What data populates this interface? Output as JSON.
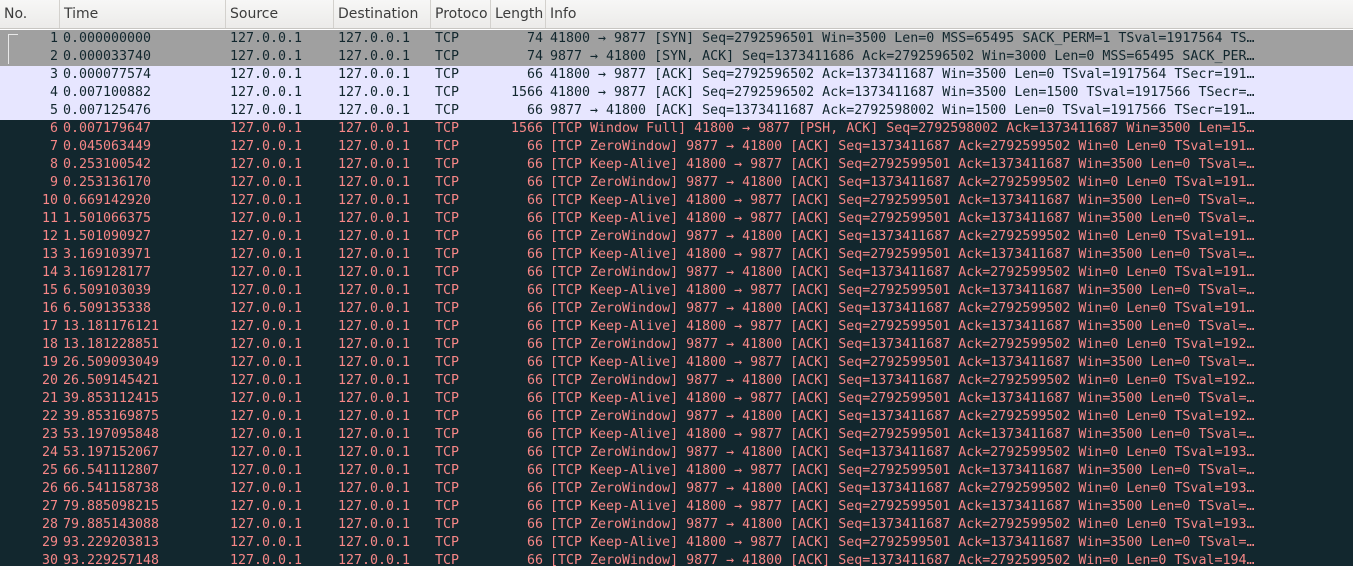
{
  "columns": [
    {
      "key": "no",
      "label": "No."
    },
    {
      "key": "time",
      "label": "Time"
    },
    {
      "key": "source",
      "label": "Source"
    },
    {
      "key": "destination",
      "label": "Destination"
    },
    {
      "key": "protocol",
      "label": "Protoco"
    },
    {
      "key": "length",
      "label": "Length"
    },
    {
      "key": "info",
      "label": "Info"
    }
  ],
  "colors": {
    "gray_bg": "#a0a0a0",
    "gray_fg": "#12272e",
    "lavender_bg": "#e7e6ff",
    "lavender_fg": "#12272e",
    "dark_bg": "#12272e",
    "dark_fg": "#f78787"
  },
  "packets": [
    {
      "no": "1",
      "time": "0.000000000",
      "source": "127.0.0.1",
      "destination": "127.0.0.1",
      "protocol": "TCP",
      "length": "74",
      "info": "41800 → 9877 [SYN] Seq=2792596501 Win=3500 Len=0 MSS=65495 SACK_PERM=1 TSval=1917564 TS…",
      "style": "gray"
    },
    {
      "no": "2",
      "time": "0.000033740",
      "source": "127.0.0.1",
      "destination": "127.0.0.1",
      "protocol": "TCP",
      "length": "74",
      "info": "9877 → 41800 [SYN, ACK] Seq=1373411686 Ack=2792596502 Win=3000 Len=0 MSS=65495 SACK_PER…",
      "style": "gray"
    },
    {
      "no": "3",
      "time": "0.000077574",
      "source": "127.0.0.1",
      "destination": "127.0.0.1",
      "protocol": "TCP",
      "length": "66",
      "info": "41800 → 9877 [ACK] Seq=2792596502 Ack=1373411687 Win=3500 Len=0 TSval=1917564 TSecr=191…",
      "style": "lavender"
    },
    {
      "no": "4",
      "time": "0.007100882",
      "source": "127.0.0.1",
      "destination": "127.0.0.1",
      "protocol": "TCP",
      "length": "1566",
      "info": "41800 → 9877 [ACK] Seq=2792596502 Ack=1373411687 Win=3500 Len=1500 TSval=1917566 TSecr=…",
      "style": "lavender"
    },
    {
      "no": "5",
      "time": "0.007125476",
      "source": "127.0.0.1",
      "destination": "127.0.0.1",
      "protocol": "TCP",
      "length": "66",
      "info": "9877 → 41800 [ACK] Seq=1373411687 Ack=2792598002 Win=1500 Len=0 TSval=1917566 TSecr=191…",
      "style": "lavender"
    },
    {
      "no": "6",
      "time": "0.007179647",
      "source": "127.0.0.1",
      "destination": "127.0.0.1",
      "protocol": "TCP",
      "length": "1566",
      "info": "[TCP Window Full] 41800 → 9877 [PSH, ACK] Seq=2792598002 Ack=1373411687 Win=3500 Len=15…",
      "style": "dark"
    },
    {
      "no": "7",
      "time": "0.045063449",
      "source": "127.0.0.1",
      "destination": "127.0.0.1",
      "protocol": "TCP",
      "length": "66",
      "info": "[TCP ZeroWindow] 9877 → 41800 [ACK] Seq=1373411687 Ack=2792599502 Win=0 Len=0 TSval=191…",
      "style": "dark"
    },
    {
      "no": "8",
      "time": "0.253100542",
      "source": "127.0.0.1",
      "destination": "127.0.0.1",
      "protocol": "TCP",
      "length": "66",
      "info": "[TCP Keep-Alive] 41800 → 9877 [ACK] Seq=2792599501 Ack=1373411687 Win=3500 Len=0 TSval=…",
      "style": "dark"
    },
    {
      "no": "9",
      "time": "0.253136170",
      "source": "127.0.0.1",
      "destination": "127.0.0.1",
      "protocol": "TCP",
      "length": "66",
      "info": "[TCP ZeroWindow] 9877 → 41800 [ACK] Seq=1373411687 Ack=2792599502 Win=0 Len=0 TSval=191…",
      "style": "dark"
    },
    {
      "no": "10",
      "time": "0.669142920",
      "source": "127.0.0.1",
      "destination": "127.0.0.1",
      "protocol": "TCP",
      "length": "66",
      "info": "[TCP Keep-Alive] 41800 → 9877 [ACK] Seq=2792599501 Ack=1373411687 Win=3500 Len=0 TSval=…",
      "style": "dark"
    },
    {
      "no": "11",
      "time": "1.501066375",
      "source": "127.0.0.1",
      "destination": "127.0.0.1",
      "protocol": "TCP",
      "length": "66",
      "info": "[TCP Keep-Alive] 41800 → 9877 [ACK] Seq=2792599501 Ack=1373411687 Win=3500 Len=0 TSval=…",
      "style": "dark"
    },
    {
      "no": "12",
      "time": "1.501090927",
      "source": "127.0.0.1",
      "destination": "127.0.0.1",
      "protocol": "TCP",
      "length": "66",
      "info": "[TCP ZeroWindow] 9877 → 41800 [ACK] Seq=1373411687 Ack=2792599502 Win=0 Len=0 TSval=191…",
      "style": "dark"
    },
    {
      "no": "13",
      "time": "3.169103971",
      "source": "127.0.0.1",
      "destination": "127.0.0.1",
      "protocol": "TCP",
      "length": "66",
      "info": "[TCP Keep-Alive] 41800 → 9877 [ACK] Seq=2792599501 Ack=1373411687 Win=3500 Len=0 TSval=…",
      "style": "dark"
    },
    {
      "no": "14",
      "time": "3.169128177",
      "source": "127.0.0.1",
      "destination": "127.0.0.1",
      "protocol": "TCP",
      "length": "66",
      "info": "[TCP ZeroWindow] 9877 → 41800 [ACK] Seq=1373411687 Ack=2792599502 Win=0 Len=0 TSval=191…",
      "style": "dark"
    },
    {
      "no": "15",
      "time": "6.509103039",
      "source": "127.0.0.1",
      "destination": "127.0.0.1",
      "protocol": "TCP",
      "length": "66",
      "info": "[TCP Keep-Alive] 41800 → 9877 [ACK] Seq=2792599501 Ack=1373411687 Win=3500 Len=0 TSval=…",
      "style": "dark"
    },
    {
      "no": "16",
      "time": "6.509135338",
      "source": "127.0.0.1",
      "destination": "127.0.0.1",
      "protocol": "TCP",
      "length": "66",
      "info": "[TCP ZeroWindow] 9877 → 41800 [ACK] Seq=1373411687 Ack=2792599502 Win=0 Len=0 TSval=191…",
      "style": "dark"
    },
    {
      "no": "17",
      "time": "13.181176121",
      "source": "127.0.0.1",
      "destination": "127.0.0.1",
      "protocol": "TCP",
      "length": "66",
      "info": "[TCP Keep-Alive] 41800 → 9877 [ACK] Seq=2792599501 Ack=1373411687 Win=3500 Len=0 TSval=…",
      "style": "dark"
    },
    {
      "no": "18",
      "time": "13.181228851",
      "source": "127.0.0.1",
      "destination": "127.0.0.1",
      "protocol": "TCP",
      "length": "66",
      "info": "[TCP ZeroWindow] 9877 → 41800 [ACK] Seq=1373411687 Ack=2792599502 Win=0 Len=0 TSval=192…",
      "style": "dark"
    },
    {
      "no": "19",
      "time": "26.509093049",
      "source": "127.0.0.1",
      "destination": "127.0.0.1",
      "protocol": "TCP",
      "length": "66",
      "info": "[TCP Keep-Alive] 41800 → 9877 [ACK] Seq=2792599501 Ack=1373411687 Win=3500 Len=0 TSval=…",
      "style": "dark"
    },
    {
      "no": "20",
      "time": "26.509145421",
      "source": "127.0.0.1",
      "destination": "127.0.0.1",
      "protocol": "TCP",
      "length": "66",
      "info": "[TCP ZeroWindow] 9877 → 41800 [ACK] Seq=1373411687 Ack=2792599502 Win=0 Len=0 TSval=192…",
      "style": "dark"
    },
    {
      "no": "21",
      "time": "39.853112415",
      "source": "127.0.0.1",
      "destination": "127.0.0.1",
      "protocol": "TCP",
      "length": "66",
      "info": "[TCP Keep-Alive] 41800 → 9877 [ACK] Seq=2792599501 Ack=1373411687 Win=3500 Len=0 TSval=…",
      "style": "dark"
    },
    {
      "no": "22",
      "time": "39.853169875",
      "source": "127.0.0.1",
      "destination": "127.0.0.1",
      "protocol": "TCP",
      "length": "66",
      "info": "[TCP ZeroWindow] 9877 → 41800 [ACK] Seq=1373411687 Ack=2792599502 Win=0 Len=0 TSval=192…",
      "style": "dark"
    },
    {
      "no": "23",
      "time": "53.197095848",
      "source": "127.0.0.1",
      "destination": "127.0.0.1",
      "protocol": "TCP",
      "length": "66",
      "info": "[TCP Keep-Alive] 41800 → 9877 [ACK] Seq=2792599501 Ack=1373411687 Win=3500 Len=0 TSval=…",
      "style": "dark"
    },
    {
      "no": "24",
      "time": "53.197152067",
      "source": "127.0.0.1",
      "destination": "127.0.0.1",
      "protocol": "TCP",
      "length": "66",
      "info": "[TCP ZeroWindow] 9877 → 41800 [ACK] Seq=1373411687 Ack=2792599502 Win=0 Len=0 TSval=193…",
      "style": "dark"
    },
    {
      "no": "25",
      "time": "66.541112807",
      "source": "127.0.0.1",
      "destination": "127.0.0.1",
      "protocol": "TCP",
      "length": "66",
      "info": "[TCP Keep-Alive] 41800 → 9877 [ACK] Seq=2792599501 Ack=1373411687 Win=3500 Len=0 TSval=…",
      "style": "dark"
    },
    {
      "no": "26",
      "time": "66.541158738",
      "source": "127.0.0.1",
      "destination": "127.0.0.1",
      "protocol": "TCP",
      "length": "66",
      "info": "[TCP ZeroWindow] 9877 → 41800 [ACK] Seq=1373411687 Ack=2792599502 Win=0 Len=0 TSval=193…",
      "style": "dark"
    },
    {
      "no": "27",
      "time": "79.885098215",
      "source": "127.0.0.1",
      "destination": "127.0.0.1",
      "protocol": "TCP",
      "length": "66",
      "info": "[TCP Keep-Alive] 41800 → 9877 [ACK] Seq=2792599501 Ack=1373411687 Win=3500 Len=0 TSval=…",
      "style": "dark"
    },
    {
      "no": "28",
      "time": "79.885143088",
      "source": "127.0.0.1",
      "destination": "127.0.0.1",
      "protocol": "TCP",
      "length": "66",
      "info": "[TCP ZeroWindow] 9877 → 41800 [ACK] Seq=1373411687 Ack=2792599502 Win=0 Len=0 TSval=193…",
      "style": "dark"
    },
    {
      "no": "29",
      "time": "93.229203813",
      "source": "127.0.0.1",
      "destination": "127.0.0.1",
      "protocol": "TCP",
      "length": "66",
      "info": "[TCP Keep-Alive] 41800 → 9877 [ACK] Seq=2792599501 Ack=1373411687 Win=3500 Len=0 TSval=…",
      "style": "dark"
    },
    {
      "no": "30",
      "time": "93.229257148",
      "source": "127.0.0.1",
      "destination": "127.0.0.1",
      "protocol": "TCP",
      "length": "66",
      "info": "[TCP ZeroWindow] 9877 → 41800 [ACK] Seq=1373411687 Ack=2792599502 Win=0 Len=0 TSval=194…",
      "style": "dark"
    }
  ]
}
